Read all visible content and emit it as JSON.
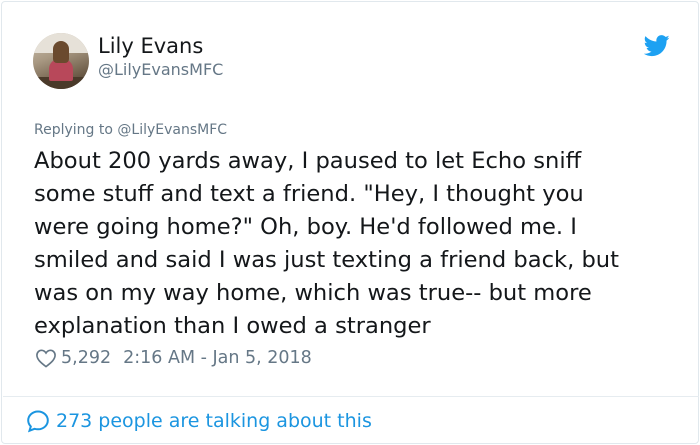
{
  "user": {
    "name": "Lily Evans",
    "handle": "@LilyEvansMFC"
  },
  "reply": {
    "prefix": "Replying to ",
    "mention": "@LilyEvansMFC"
  },
  "tweet": {
    "lines": [
      "About 200 yards away, I paused to let Echo sniff",
      "some stuff and text a friend. \"Hey, I thought you",
      "were going home?\" Oh, boy. He'd followed me. I",
      "smiled and said I was just texting a friend back, but",
      "was on my way home, which was true-- but more",
      "explanation than I owed a stranger"
    ]
  },
  "meta": {
    "likes": "5,292",
    "timestamp": "2:16 AM - Jan 5, 2018"
  },
  "footer": {
    "talking": "273 people are talking about this"
  },
  "icons": {
    "bird": "twitter-bird-icon",
    "heart": "heart-icon",
    "bubble": "comment-bubble-icon"
  },
  "colors": {
    "twitter_blue": "#1da1f2",
    "link_blue": "#1b95e0",
    "secondary_text": "#657786",
    "primary_text": "#14171a"
  }
}
